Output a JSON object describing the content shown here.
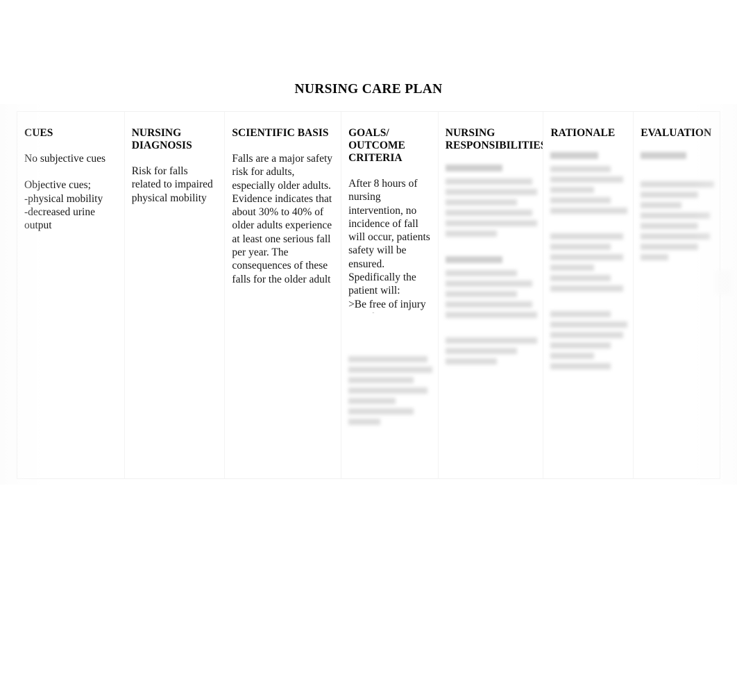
{
  "document": {
    "title": "NURSING CARE PLAN"
  },
  "table": {
    "columns": [
      {
        "key": "cues",
        "header": "CUES",
        "body": "No subjective cues",
        "body2": "Objective cues;\n-physical mobility\n-decreased urine\noutput",
        "redacted": false
      },
      {
        "key": "nursing_diagnosis",
        "header": "NURSING DIAGNOSIS",
        "body": "Risk for falls\nrelated to impaired\nphysical mobility",
        "redacted": false
      },
      {
        "key": "scientific_basis",
        "header": "SCIENTIFIC BASIS",
        "body": "Falls are a major safety risk for adults, especially older adults. Evidence indicates that about 30% to 40% of older adults experience at least one serious fall per year. The consequences of these falls for the older adult represent a major",
        "clipped": true,
        "redacted": false
      },
      {
        "key": "goals_outcome_criteria",
        "header": "GOALS/ OUTCOME CRITERIA",
        "body": "After 8 hours of nursing intervention, no incidence of fall will occur, patients safety will be ensured. Spedifically the patient will:\n>Be free of injury\n>Modify",
        "clipped": true,
        "redacted": false,
        "redacted_block": true
      },
      {
        "key": "nursing_responsibilities",
        "header": "NURSING RESPONSIBILITIES",
        "body": "",
        "redacted": true
      },
      {
        "key": "rationale",
        "header": "RATIONALE",
        "body": "",
        "redacted": true
      },
      {
        "key": "evaluation",
        "header": "EVALUATION",
        "body": "",
        "redacted": true
      }
    ]
  }
}
